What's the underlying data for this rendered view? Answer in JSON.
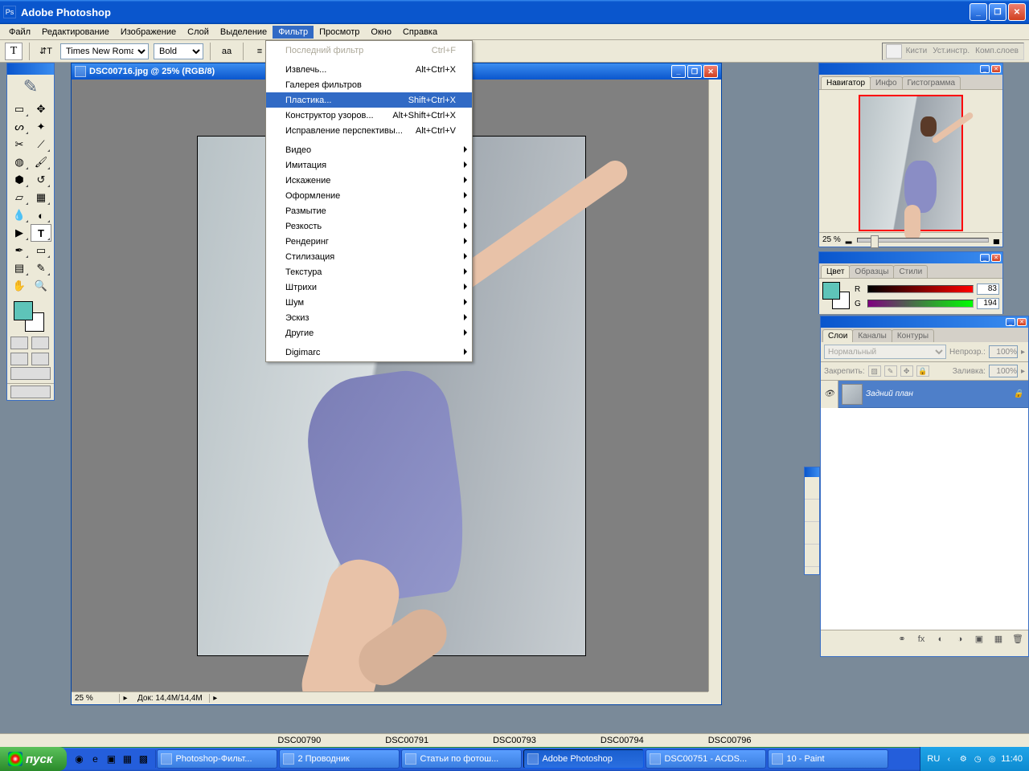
{
  "app": {
    "title": "Adobe Photoshop"
  },
  "menubar": [
    "Файл",
    "Редактирование",
    "Изображение",
    "Слой",
    "Выделение",
    "Фильтр",
    "Просмотр",
    "Окно",
    "Справка"
  ],
  "menubar_active_index": 5,
  "optionsbar": {
    "tool_letter": "T",
    "font": "Times New Roman",
    "weight": "Bold",
    "color": "#5ec4b9"
  },
  "palette_well": [
    "Кисти",
    "Уст.инстр.",
    "Комп.слоев"
  ],
  "document": {
    "title": "DSC00716.jpg @ 25% (RGB/8)",
    "zoom": "25 %",
    "status": "Док: 14,4M/14,4M"
  },
  "filter_menu": [
    {
      "type": "item",
      "label": "Последний фильтр",
      "shortcut": "Ctrl+F",
      "disabled": true
    },
    {
      "type": "sep"
    },
    {
      "type": "item",
      "label": "Извлечь...",
      "shortcut": "Alt+Ctrl+X"
    },
    {
      "type": "item",
      "label": "Галерея фильтров"
    },
    {
      "type": "item",
      "label": "Пластика...",
      "shortcut": "Shift+Ctrl+X",
      "highlight": true
    },
    {
      "type": "item",
      "label": "Конструктор узоров...",
      "shortcut": "Alt+Shift+Ctrl+X"
    },
    {
      "type": "item",
      "label": "Исправление перспективы...",
      "shortcut": "Alt+Ctrl+V"
    },
    {
      "type": "sep"
    },
    {
      "type": "sub",
      "label": "Видео"
    },
    {
      "type": "sub",
      "label": "Имитация"
    },
    {
      "type": "sub",
      "label": "Искажение"
    },
    {
      "type": "sub",
      "label": "Оформление"
    },
    {
      "type": "sub",
      "label": "Размытие"
    },
    {
      "type": "sub",
      "label": "Резкость"
    },
    {
      "type": "sub",
      "label": "Рендеринг"
    },
    {
      "type": "sub",
      "label": "Стилизация"
    },
    {
      "type": "sub",
      "label": "Текстура"
    },
    {
      "type": "sub",
      "label": "Штрихи"
    },
    {
      "type": "sub",
      "label": "Шум"
    },
    {
      "type": "sub",
      "label": "Эскиз"
    },
    {
      "type": "sub",
      "label": "Другие"
    },
    {
      "type": "sep"
    },
    {
      "type": "sub",
      "label": "Digimarc"
    }
  ],
  "navigator": {
    "tabs": [
      "Навигатор",
      "Инфо",
      "Гистограмма"
    ],
    "active_tab": 0,
    "zoom": "25 %"
  },
  "color": {
    "tabs": [
      "Цвет",
      "Образцы",
      "Стили"
    ],
    "active_tab": 0,
    "channels": [
      {
        "label": "R",
        "value": "83"
      },
      {
        "label": "G",
        "value": "194"
      }
    ]
  },
  "layers": {
    "tabs": [
      "Слои",
      "Каналы",
      "Контуры"
    ],
    "active_tab": 0,
    "blend_mode": "Нормальный",
    "opacity_label": "Непрозр.:",
    "opacity": "100%",
    "lock_label": "Закрепить:",
    "fill_label": "Заливка:",
    "fill": "100%",
    "layer_name": "Задний план"
  },
  "thumb_bar": [
    "DSC00790",
    "DSC00791",
    "DSC00793",
    "DSC00794",
    "DSC00796"
  ],
  "taskbar": {
    "start": "пуск",
    "tasks": [
      {
        "label": "Photoshop-Фильт...",
        "active": false
      },
      {
        "label": "2 Проводник",
        "active": false
      },
      {
        "label": "Статьи по фотош...",
        "active": false
      },
      {
        "label": "Adobe Photoshop",
        "active": true
      },
      {
        "label": "DSC00751 - ACDS...",
        "active": false
      },
      {
        "label": "10 - Paint",
        "active": false
      }
    ],
    "lang": "RU",
    "time": "11:40"
  }
}
